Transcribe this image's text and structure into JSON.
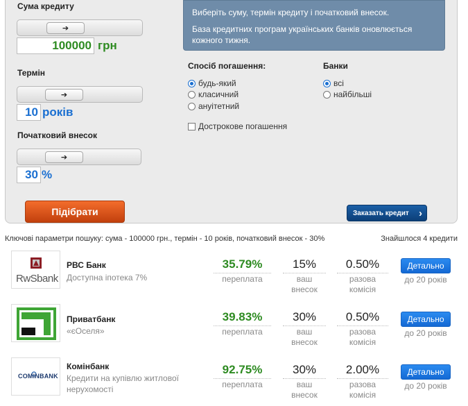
{
  "info": {
    "line1": "Виберіть суму, термін кредиту і початковий внесок.",
    "line2": "База кредитних програм українських банків оновлюється кожного тижня."
  },
  "amount": {
    "label": "Сума кредиту",
    "value": "100000",
    "unit": "грн"
  },
  "term": {
    "label": "Термін",
    "value": "10",
    "unit": "років"
  },
  "down": {
    "label": "Початковий внесок",
    "value": "30",
    "unit": "%"
  },
  "slider_arrow": "➔",
  "pick_button": "Підібрати",
  "repayment": {
    "title": "Спосіб погашення:",
    "options": [
      "будь-який",
      "класичний",
      "ануітетний"
    ],
    "selected": "будь-який"
  },
  "banks_filter": {
    "title": "Банки",
    "options": [
      "всі",
      "найбільші"
    ],
    "selected": "всі"
  },
  "early_repayment": "Дострокове погашення",
  "order_button": "Заказать кредит",
  "order_arrow": "›",
  "summary": "Ключові параметри пошуку: сума - 100000 грн., термін - 10 років, початковий внесок - 30%",
  "found": "Знайшлося 4 кредити",
  "labels": {
    "overpay": "переплата",
    "your": "ваш",
    "contribution": "внесок",
    "onetime": "разова",
    "commission": "комісія",
    "details": "Детально"
  },
  "offers": [
    {
      "bank": "РВС Банк",
      "program": "Доступна іпотека 7%",
      "logo": "RwSbank",
      "overpay": "35.79%",
      "down": "15%",
      "commission": "0.50%",
      "term": "до 20 років"
    },
    {
      "bank": "Приватбанк",
      "program": "«єОселя»",
      "logo": "privatbank-logo",
      "overpay": "39.83%",
      "down": "30%",
      "commission": "0.50%",
      "term": "до 20 років"
    },
    {
      "bank": "Комінбанк",
      "program": "Кредити на купівлю житлової нерухомості",
      "logo": "COMINBANK",
      "overpay": "92.75%",
      "down": "30%",
      "commission": "2.00%",
      "term": "до 20 років"
    }
  ],
  "colors": {
    "accent_green": "#2e8b22",
    "orange_button": "#e35c1c",
    "blue_button": "#1b5fa6",
    "details_button": "#1f7ae0",
    "info_box": "#6f8ca9"
  }
}
